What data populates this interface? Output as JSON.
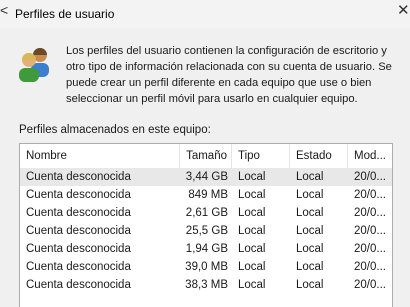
{
  "window": {
    "title": "Perfiles de usuario",
    "close_glyph": "✕",
    "left_glyph": "<"
  },
  "description": "Los perfiles del usuario contienen la configuración de escritorio y otro tipo de información relacionada con su cuenta de usuario. Se puede crear un perfil diferente en cada equipo que use o bien seleccionar un perfil móvil para usarlo en cualquier equipo.",
  "icon": "users-icon",
  "profiles": {
    "label": "Perfiles almacenados en este equipo:",
    "columns": [
      "Nombre",
      "Tamaño",
      "Tipo",
      "Estado",
      "Mod..."
    ],
    "rows": [
      {
        "name": "Cuenta desconocida",
        "size": "3,44 GB",
        "type": "Local",
        "status": "Local",
        "modified": "20/0..."
      },
      {
        "name": "Cuenta desconocida",
        "size": "849 MB",
        "type": "Local",
        "status": "Local",
        "modified": "20/0..."
      },
      {
        "name": "Cuenta desconocida",
        "size": "2,61 GB",
        "type": "Local",
        "status": "Local",
        "modified": "20/0..."
      },
      {
        "name": "Cuenta desconocida",
        "size": "25,5 GB",
        "type": "Local",
        "status": "Local",
        "modified": "20/0..."
      },
      {
        "name": "Cuenta desconocida",
        "size": "1,94 GB",
        "type": "Local",
        "status": "Local",
        "modified": "20/0..."
      },
      {
        "name": "Cuenta desconocida",
        "size": "39,0 MB",
        "type": "Local",
        "status": "Local",
        "modified": "20/0..."
      },
      {
        "name": "Cuenta desconocida",
        "size": "38,3 MB",
        "type": "Local",
        "status": "Local",
        "modified": "20/0..."
      }
    ],
    "selected_index": 0
  },
  "colors": {
    "window_bg": "#f0f0f0",
    "list_bg": "#ffffff",
    "selected_row": "#e8e8e8",
    "border": "#adadad"
  }
}
